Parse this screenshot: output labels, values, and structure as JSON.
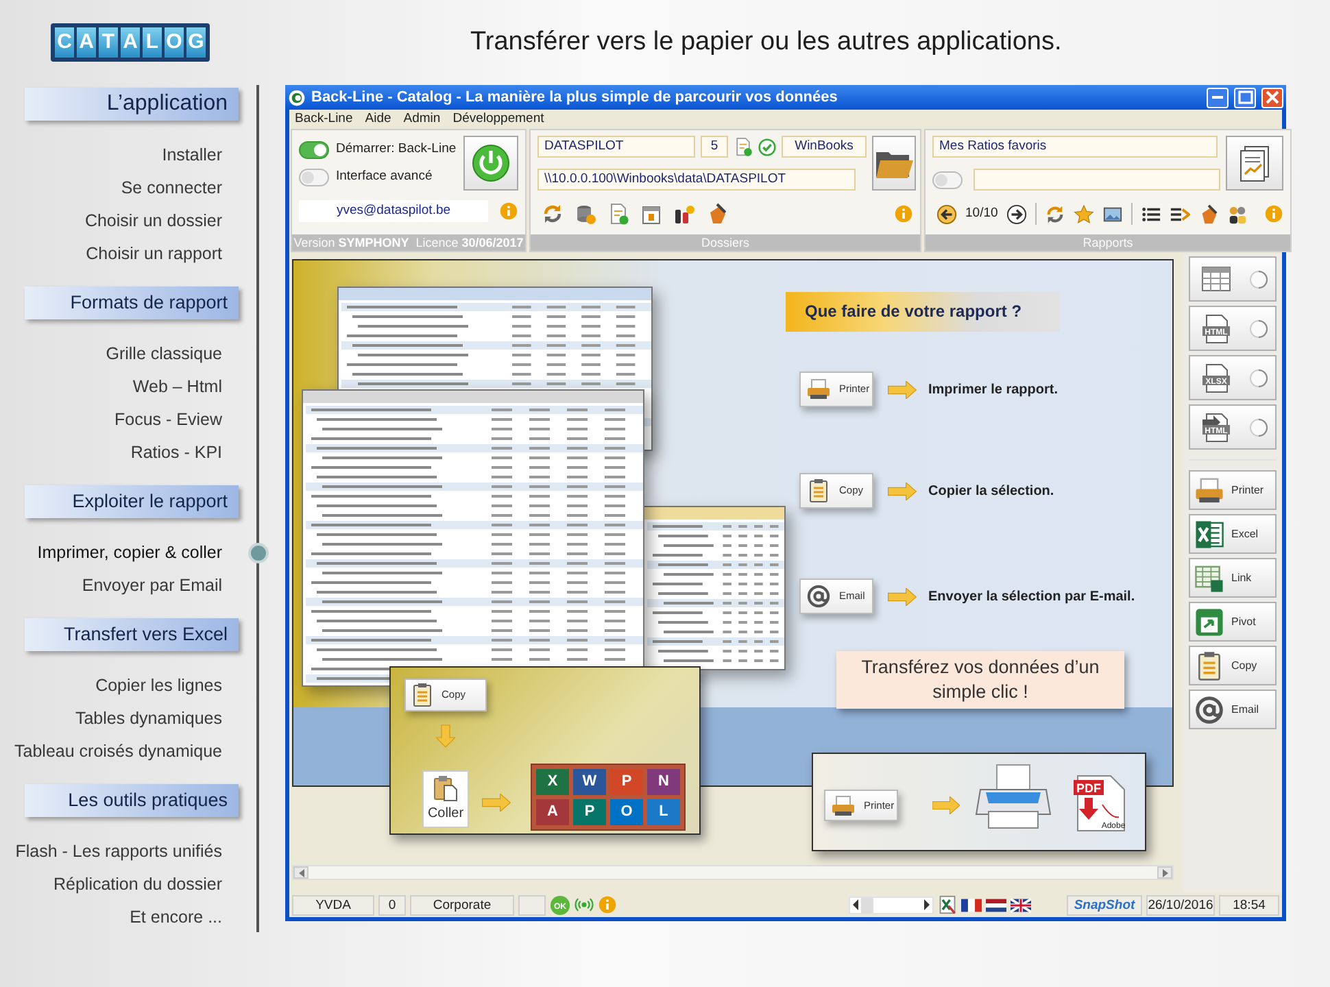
{
  "header": {
    "logo": [
      "C",
      "A",
      "T",
      "A",
      "L",
      "O",
      "G"
    ],
    "title": "Transférer vers le papier ou les autres applications."
  },
  "sidebar": {
    "sections": [
      {
        "title": "L’application",
        "items": [
          {
            "label": "Installer",
            "selected": false
          },
          {
            "label": "Se connecter",
            "selected": false
          },
          {
            "label": "Choisir un dossier",
            "selected": false
          },
          {
            "label": "Choisir un rapport",
            "selected": false
          }
        ]
      },
      {
        "title": "Formats de rapport",
        "items": [
          {
            "label": "Grille classique",
            "selected": false
          },
          {
            "label": "Web – Html",
            "selected": false
          },
          {
            "label": "Focus - Eview",
            "selected": false
          },
          {
            "label": "Ratios - KPI",
            "selected": false
          }
        ]
      },
      {
        "title": "Exploiter le rapport",
        "items": [
          {
            "label": "Imprimer, copier & coller",
            "selected": true
          },
          {
            "label": "Envoyer par Email",
            "selected": false
          }
        ]
      },
      {
        "title": "Transfert vers Excel",
        "items": [
          {
            "label": "Copier les lignes",
            "selected": false
          },
          {
            "label": "Tables dynamiques",
            "selected": false
          },
          {
            "label": "Tableau croisés dynamique",
            "selected": false
          }
        ]
      },
      {
        "title": "Les outils pratiques",
        "items": [
          {
            "label": "Flash - Les rapports unifiés",
            "selected": false
          },
          {
            "label": "Réplication du dossier",
            "selected": false
          },
          {
            "label": "Et encore ...",
            "selected": false
          }
        ]
      }
    ]
  },
  "window": {
    "title": "Back-Line - Catalog - La manière la plus simple de parcourir vos données",
    "menu": [
      "Back-Line",
      "Aide",
      "Admin",
      "Développement"
    ],
    "session_panel": {
      "toggles": [
        {
          "label": "Démarrer: Back-Line",
          "on": true
        },
        {
          "label": "Interface avancé",
          "on": false
        }
      ],
      "email": "yves@dataspilot.be",
      "version_label": "Version",
      "version": "SYMPHONY",
      "licence_label": "Licence",
      "licence": "30/06/2017"
    },
    "folders_panel": {
      "database": "DATASPILOT",
      "count": "5",
      "software": "WinBooks",
      "path": "\\\\10.0.0.100\\Winbooks\\data\\DATASPILOT",
      "footer": "Dossiers"
    },
    "reports_panel": {
      "favorites": "Mes Ratios favoris",
      "filter_on": false,
      "pager": "10/10",
      "footer": "Rapports"
    },
    "format_buttons": [
      {
        "kind": "grid",
        "selected": false
      },
      {
        "kind": "doc",
        "icon_text": "HTML",
        "selected": false
      },
      {
        "kind": "doc",
        "icon_text": "XLSX",
        "selected": false
      },
      {
        "kind": "export",
        "icon_text": "HTML",
        "selected": false
      }
    ],
    "action_buttons": [
      {
        "kind": "printer",
        "label": "Printer"
      },
      {
        "kind": "excel",
        "label": "Excel"
      },
      {
        "kind": "link",
        "label": "Link"
      },
      {
        "kind": "pivot",
        "label": "Pivot"
      },
      {
        "kind": "copy",
        "label": "Copy"
      },
      {
        "kind": "email",
        "label": "Email"
      }
    ],
    "slide": {
      "banner": "Que faire de votre rapport ?",
      "actions": [
        {
          "kind": "printer",
          "button": "Printer",
          "text": "Imprimer le rapport."
        },
        {
          "kind": "copy",
          "button": "Copy",
          "text": "Copier la sélection."
        },
        {
          "kind": "email",
          "button": "Email",
          "text": "Envoyer la sélection par E-mail."
        }
      ],
      "callout": "Transférez vos données d’un simple clic !",
      "paste_demo": {
        "copy_button": "Copy",
        "paste_button": "Coller",
        "office_apps": [
          {
            "letter": "X",
            "color": "#1f7244"
          },
          {
            "letter": "W",
            "color": "#2b579a"
          },
          {
            "letter": "P",
            "color": "#d24726"
          },
          {
            "letter": "N",
            "color": "#80397b"
          },
          {
            "letter": "A",
            "color": "#a4373a"
          },
          {
            "letter": "P",
            "color": "#077568"
          },
          {
            "letter": "O",
            "color": "#0072c6"
          },
          {
            "letter": "L",
            "color": "#1b79c8"
          }
        ]
      },
      "print_demo": {
        "button": "Printer",
        "pdf_label": "PDF",
        "pdf_brand": "Adobe"
      }
    },
    "status_bar": {
      "user": "YVDA",
      "count": "0",
      "profile": "Corporate",
      "ok_label": "OK",
      "slider": {
        "level": 0.2
      },
      "snapshot": "SnapShot",
      "date": "26/10/2016",
      "time": "18:54"
    }
  }
}
